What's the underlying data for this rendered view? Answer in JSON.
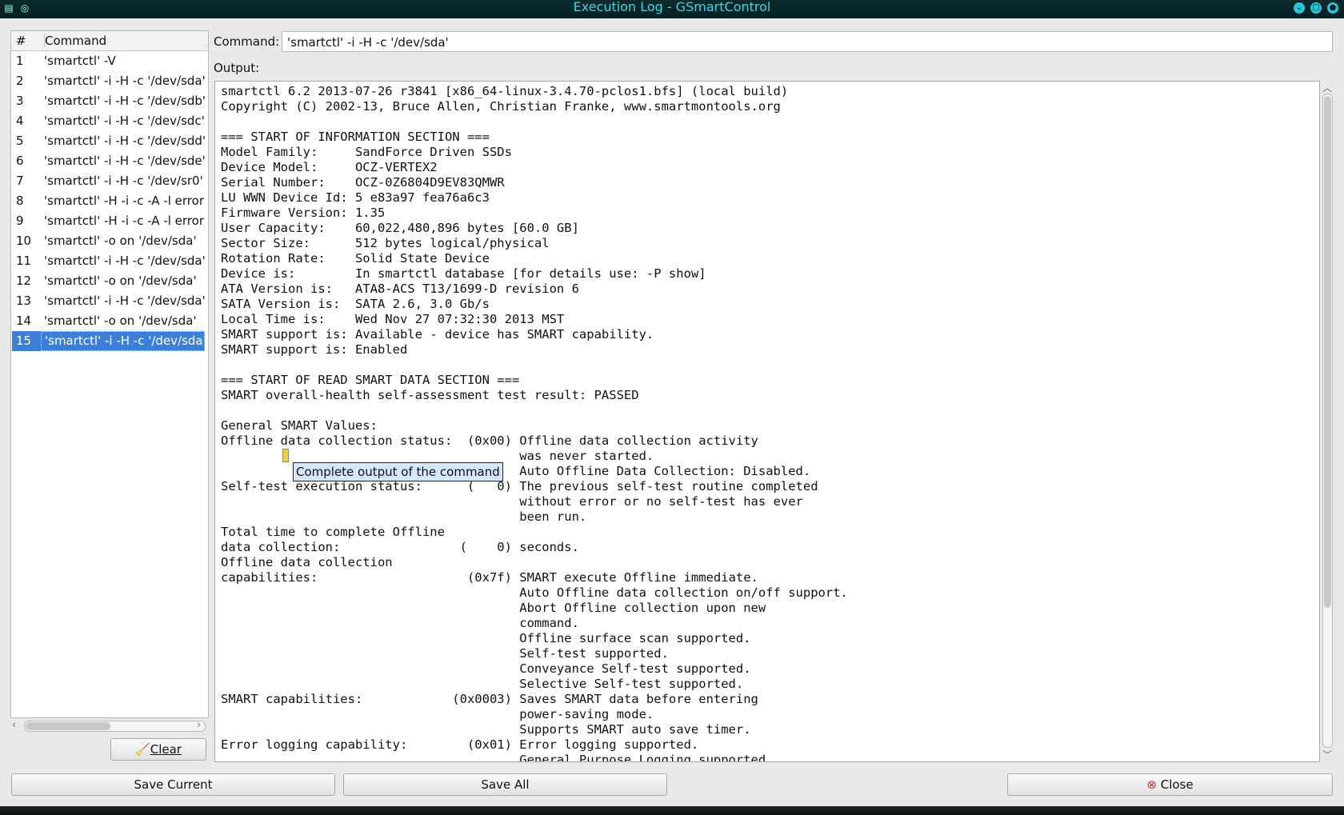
{
  "window": {
    "title": "Execution Log - GSmartControl"
  },
  "list": {
    "header_num": "#",
    "header_cmd": "Command",
    "rows": [
      {
        "num": "1",
        "cmd": "'smartctl' -V"
      },
      {
        "num": "2",
        "cmd": "'smartctl' -i -H -c '/dev/sda'"
      },
      {
        "num": "3",
        "cmd": "'smartctl' -i -H -c '/dev/sdb'"
      },
      {
        "num": "4",
        "cmd": "'smartctl' -i -H -c '/dev/sdc'"
      },
      {
        "num": "5",
        "cmd": "'smartctl' -i -H -c '/dev/sdd'"
      },
      {
        "num": "6",
        "cmd": "'smartctl' -i -H -c '/dev/sde'"
      },
      {
        "num": "7",
        "cmd": "'smartctl' -i -H -c '/dev/sr0'"
      },
      {
        "num": "8",
        "cmd": "'smartctl' -H -i -c -A -l error -"
      },
      {
        "num": "9",
        "cmd": "'smartctl' -H -i -c -A -l error -"
      },
      {
        "num": "10",
        "cmd": "'smartctl' -o on '/dev/sda'"
      },
      {
        "num": "11",
        "cmd": "'smartctl' -i -H -c '/dev/sda'"
      },
      {
        "num": "12",
        "cmd": "'smartctl' -o on '/dev/sda'"
      },
      {
        "num": "13",
        "cmd": "'smartctl' -i -H -c '/dev/sda'"
      },
      {
        "num": "14",
        "cmd": "'smartctl' -o on '/dev/sda'"
      },
      {
        "num": "15",
        "cmd": "'smartctl' -i -H -c '/dev/sda'",
        "selected": true
      }
    ],
    "clear_label": "Clear"
  },
  "command": {
    "label": "Command:",
    "value": "'smartctl' -i -H -c '/dev/sda'"
  },
  "output": {
    "label": "Output:",
    "text": "smartctl 6.2 2013-07-26 r3841 [x86_64-linux-3.4.70-pclos1.bfs] (local build)\nCopyright (C) 2002-13, Bruce Allen, Christian Franke, www.smartmontools.org\n\n=== START OF INFORMATION SECTION ===\nModel Family:     SandForce Driven SSDs\nDevice Model:     OCZ-VERTEX2\nSerial Number:    OCZ-0Z6804D9EV83QMWR\nLU WWN Device Id: 5 e83a97 fea76a6c3\nFirmware Version: 1.35\nUser Capacity:    60,022,480,896 bytes [60.0 GB]\nSector Size:      512 bytes logical/physical\nRotation Rate:    Solid State Device\nDevice is:        In smartctl database [for details use: -P show]\nATA Version is:   ATA8-ACS T13/1699-D revision 6\nSATA Version is:  SATA 2.6, 3.0 Gb/s\nLocal Time is:    Wed Nov 27 07:32:30 2013 MST\nSMART support is: Available - device has SMART capability.\nSMART support is: Enabled\n\n=== START OF READ SMART DATA SECTION ===\nSMART overall-health self-assessment test result: PASSED\n\nGeneral SMART Values:\nOffline data collection status:  (0x00) Offline data collection activity\n                                        was never started.\n                                        Auto Offline Data Collection: Disabled.\nSelf-test execution status:      (   0) The previous self-test routine completed\n                                        without error or no self-test has ever\n                                        been run.\nTotal time to complete Offline\ndata collection:                (    0) seconds.\nOffline data collection\ncapabilities:                    (0x7f) SMART execute Offline immediate.\n                                        Auto Offline data collection on/off support.\n                                        Abort Offline collection upon new\n                                        command.\n                                        Offline surface scan supported.\n                                        Self-test supported.\n                                        Conveyance Self-test supported.\n                                        Selective Self-test supported.\nSMART capabilities:            (0x0003) Saves SMART data before entering\n                                        power-saving mode.\n                                        Supports SMART auto save timer.\nError logging capability:        (0x01) Error logging supported.\n                                        General Purpose Logging supported."
  },
  "tooltip": "Complete output of the command",
  "buttons": {
    "save_current": "Save Current",
    "save_all": "Save All",
    "close": "Close"
  },
  "icons": {
    "close_icon_color": "#d62b2b",
    "selection_color": "#3d7ed6",
    "title_color": "#3fd3e6"
  }
}
